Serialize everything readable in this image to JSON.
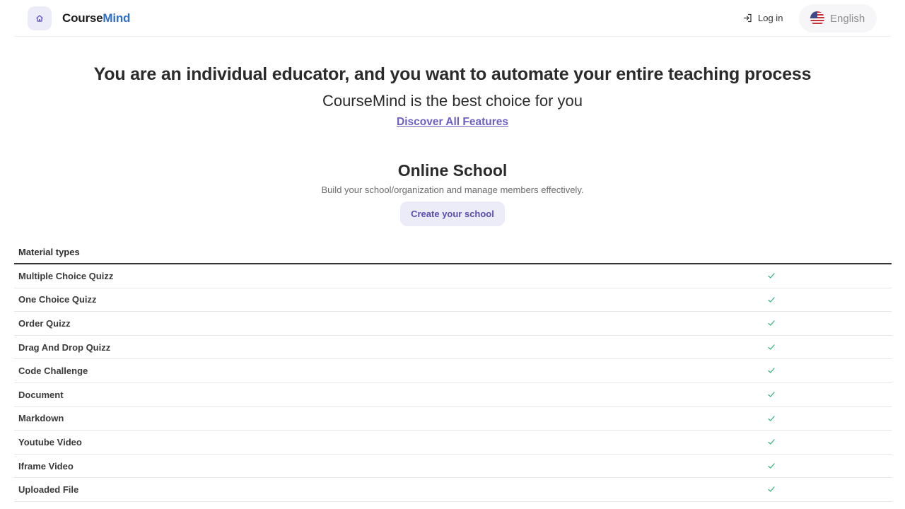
{
  "header": {
    "logo_part1": "Course",
    "logo_part2": "Mind",
    "login_label": "Log in",
    "language_label": "English",
    "icons": {
      "home": "home-icon",
      "login": "login-icon",
      "flag": "us-flag-icon"
    }
  },
  "hero": {
    "title": "You are an individual educator, and you want to automate your entire teaching process",
    "subtitle": "CourseMind is the best choice for you",
    "link_label": "Discover All Features"
  },
  "section": {
    "title": "Online School",
    "description": "Build your school/organization and manage members effectively.",
    "cta_label": "Create your school"
  },
  "table": {
    "header": "Material types",
    "rows": [
      {
        "label": "Multiple Choice Quizz",
        "included": true
      },
      {
        "label": "One Choice Quizz",
        "included": true
      },
      {
        "label": "Order Quizz",
        "included": true
      },
      {
        "label": "Drag And Drop Quizz",
        "included": true
      },
      {
        "label": "Code Challenge",
        "included": true
      },
      {
        "label": "Document",
        "included": true
      },
      {
        "label": "Markdown",
        "included": true
      },
      {
        "label": "Youtube Video",
        "included": true
      },
      {
        "label": "Iframe Video",
        "included": true
      },
      {
        "label": "Uploaded File",
        "included": true
      }
    ]
  },
  "colors": {
    "accent": "#6b5fc7",
    "logo_accent": "#2f6fd0",
    "check": "#3fb37f",
    "soft_purple": "#ecebf8"
  }
}
